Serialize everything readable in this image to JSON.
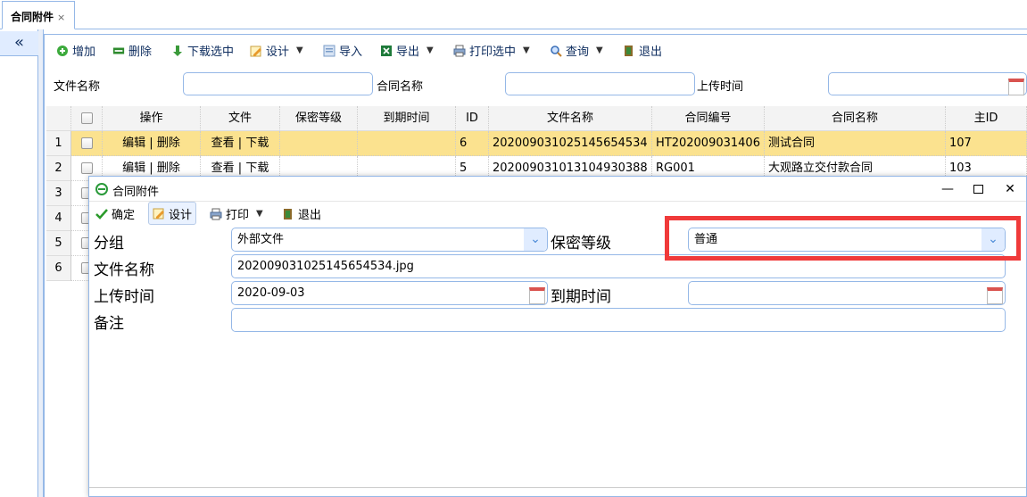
{
  "tab": {
    "label": "合同附件",
    "close": "×"
  },
  "left": {
    "collapse": "«"
  },
  "toolbar": {
    "add": "增加",
    "delete": "删除",
    "download_selected": "下载选中",
    "design": "设计",
    "import": "导入",
    "export": "导出",
    "print_selected": "打印选中",
    "query": "查询",
    "exit": "退出"
  },
  "search": {
    "file_name_label": "文件名称",
    "contract_name_label": "合同名称",
    "upload_time_label": "上传时间"
  },
  "grid": {
    "columns": [
      "操作",
      "文件",
      "保密等级",
      "到期时间",
      "ID",
      "文件名称",
      "合同编号",
      "合同名称",
      "主ID"
    ],
    "rows": [
      {
        "num": "1",
        "op": "编辑 | 删除",
        "file": "查看 | 下载",
        "secret": "",
        "expire": "",
        "id": "6",
        "file_name": "20200903102514565453​4",
        "contract_no": "HT202009031406",
        "contract_name": "测试合同",
        "main_id": "107"
      },
      {
        "num": "2",
        "op": "编辑 | 删除",
        "file": "查看 | 下载",
        "secret": "",
        "expire": "",
        "id": "5",
        "file_name": "202009031013104930388",
        "contract_no": "RG001",
        "contract_name": "大观路立交付款合同",
        "main_id": "103"
      }
    ],
    "extra_row_nums": [
      "3",
      "4",
      "5",
      "6"
    ]
  },
  "dialog": {
    "title": "合同附件",
    "toolbar": {
      "confirm": "确定",
      "design": "设计",
      "print": "打印",
      "exit": "退出"
    },
    "fields": {
      "group_label": "分组",
      "group_value": "外部文件",
      "secret_label": "保密等级",
      "secret_value": "普通",
      "file_name_label": "文件名称",
      "file_name_value": "20200903102514565453​4.jpg",
      "upload_label": "上传时间",
      "upload_value": "2020-09-03",
      "expire_label": "到期时间",
      "expire_value": "",
      "remark_label": "备注",
      "remark_value": ""
    }
  },
  "colors": {
    "accent": "#95b8e7",
    "selected_row": "#fbe28f",
    "highlight": "#f03a3a"
  }
}
